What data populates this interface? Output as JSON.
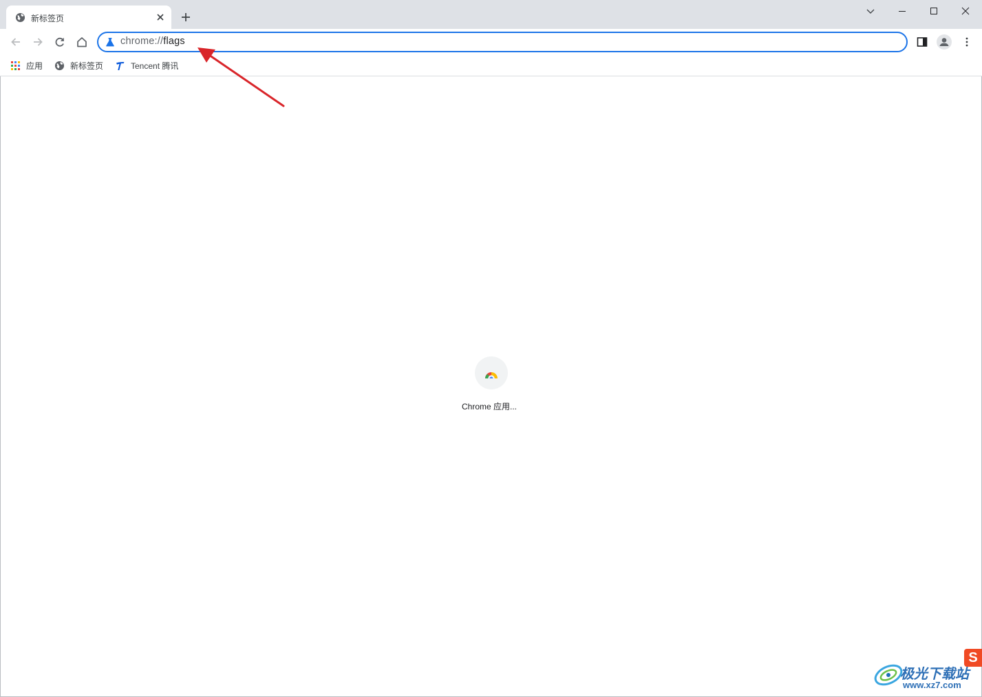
{
  "window": {
    "controls": {
      "tab_search": "chevron-down",
      "minimize": "minimize",
      "maximize": "maximize",
      "close": "close"
    }
  },
  "tab": {
    "title": "新标签页",
    "icon": "globe-icon"
  },
  "toolbar": {
    "address": {
      "scheme": "chrome://",
      "path": "flags"
    }
  },
  "bookmarks": [
    {
      "label": "应用",
      "icon": "apps-grid-icon"
    },
    {
      "label": "新标签页",
      "icon": "globe-icon"
    },
    {
      "label": "Tencent 腾讯",
      "icon": "tencent-icon"
    }
  ],
  "shortcuts": [
    {
      "label": "Chrome 应用..."
    }
  ],
  "annotation": {
    "arrow_color": "#d9252a",
    "points_to": "address-bar"
  },
  "watermark": {
    "text": "极光下载站",
    "url": "www.xz7.com"
  },
  "colors": {
    "accent": "#1a73e8",
    "tabstrip_bg": "#dee1e6"
  }
}
